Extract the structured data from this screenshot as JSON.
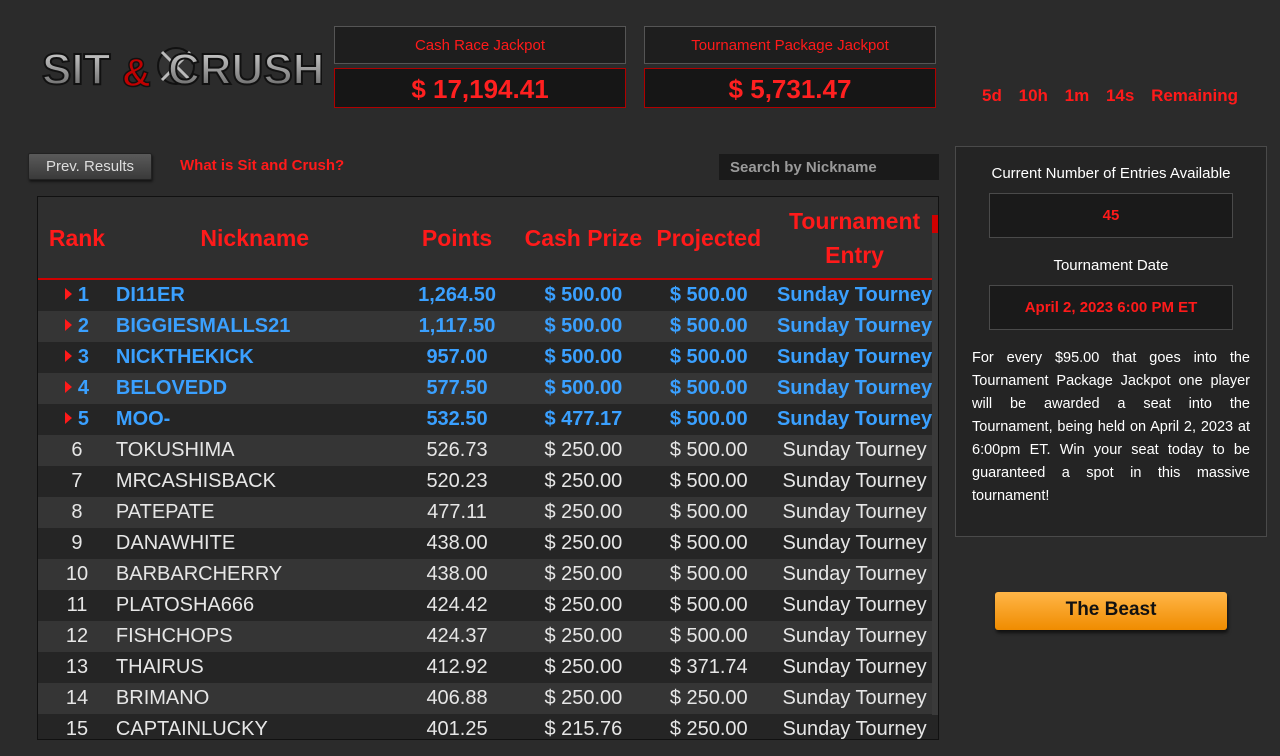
{
  "logo": {
    "alt": "SIT & CRUSH"
  },
  "jackpots": {
    "cash_race": {
      "title": "Cash Race Jackpot",
      "value": "$ 17,194.41"
    },
    "tournament_package": {
      "title": "Tournament Package Jackpot",
      "value": "$ 5,731.47"
    }
  },
  "countdown": {
    "days": "5d",
    "hours": "10h",
    "minutes": "1m",
    "seconds": "14s",
    "suffix": "Remaining"
  },
  "controls": {
    "prev_results": "Prev. Results",
    "what_is": "What is Sit and Crush?",
    "search_placeholder": "Search by Nickname"
  },
  "table": {
    "headers": {
      "rank": "Rank",
      "nickname": "Nickname",
      "points": "Points",
      "cash_prize": "Cash Prize",
      "projected": "Projected",
      "tournament_entry": "Tournament Entry"
    },
    "rows": [
      {
        "rank": "1",
        "nickname": "DI11ER",
        "points": "1,264.50",
        "cash": "$ 500.00",
        "projected": "$ 500.00",
        "entry": "Sunday Tourney",
        "top": true
      },
      {
        "rank": "2",
        "nickname": "BIGGIESMALLS21",
        "points": "1,117.50",
        "cash": "$ 500.00",
        "projected": "$ 500.00",
        "entry": "Sunday Tourney",
        "top": true
      },
      {
        "rank": "3",
        "nickname": "NICKTHEKICK",
        "points": "957.00",
        "cash": "$ 500.00",
        "projected": "$ 500.00",
        "entry": "Sunday Tourney",
        "top": true
      },
      {
        "rank": "4",
        "nickname": "BELOVEDD",
        "points": "577.50",
        "cash": "$ 500.00",
        "projected": "$ 500.00",
        "entry": "Sunday Tourney",
        "top": true
      },
      {
        "rank": "5",
        "nickname": "MOO-",
        "points": "532.50",
        "cash": "$ 477.17",
        "projected": "$ 500.00",
        "entry": "Sunday Tourney",
        "top": true
      },
      {
        "rank": "6",
        "nickname": "TOKUSHIMA",
        "points": "526.73",
        "cash": "$ 250.00",
        "projected": "$ 500.00",
        "entry": "Sunday Tourney",
        "top": false
      },
      {
        "rank": "7",
        "nickname": "MRCASHISBACK",
        "points": "520.23",
        "cash": "$ 250.00",
        "projected": "$ 500.00",
        "entry": "Sunday Tourney",
        "top": false
      },
      {
        "rank": "8",
        "nickname": "PATEPATE",
        "points": "477.11",
        "cash": "$ 250.00",
        "projected": "$ 500.00",
        "entry": "Sunday Tourney",
        "top": false
      },
      {
        "rank": "9",
        "nickname": "DANAWHITE",
        "points": "438.00",
        "cash": "$ 250.00",
        "projected": "$ 500.00",
        "entry": "Sunday Tourney",
        "top": false
      },
      {
        "rank": "10",
        "nickname": "BARBARCHERRY",
        "points": "438.00",
        "cash": "$ 250.00",
        "projected": "$ 500.00",
        "entry": "Sunday Tourney",
        "top": false
      },
      {
        "rank": "11",
        "nickname": "PLATOSHA666",
        "points": "424.42",
        "cash": "$ 250.00",
        "projected": "$ 500.00",
        "entry": "Sunday Tourney",
        "top": false
      },
      {
        "rank": "12",
        "nickname": "FISHCHOPS",
        "points": "424.37",
        "cash": "$ 250.00",
        "projected": "$ 500.00",
        "entry": "Sunday Tourney",
        "top": false
      },
      {
        "rank": "13",
        "nickname": "THAIRUS",
        "points": "412.92",
        "cash": "$ 250.00",
        "projected": "$ 371.74",
        "entry": "Sunday Tourney",
        "top": false
      },
      {
        "rank": "14",
        "nickname": "BRIMANO",
        "points": "406.88",
        "cash": "$ 250.00",
        "projected": "$ 250.00",
        "entry": "Sunday Tourney",
        "top": false
      },
      {
        "rank": "15",
        "nickname": "CAPTAINLUCKY",
        "points": "401.25",
        "cash": "$ 215.76",
        "projected": "$ 250.00",
        "entry": "Sunday Tourney",
        "top": false
      }
    ]
  },
  "panel": {
    "entries_label": "Current Number of Entries Available",
    "entries_value": "45",
    "date_label": "Tournament Date",
    "date_value": "April 2, 2023 6:00 PM ET",
    "description": "For every $95.00 that goes into the Tournament Package Jackpot one player will be awarded a seat into the Tournament, being held on April 2, 2023 at 6:00pm ET. Win your seat today to be guaranteed a spot in this massive tournament!"
  },
  "beast_button": "The Beast",
  "colors": {
    "accent_red": "#ff1a1a",
    "highlight_blue": "#3aa0ff",
    "button_orange": "#f5a020"
  }
}
